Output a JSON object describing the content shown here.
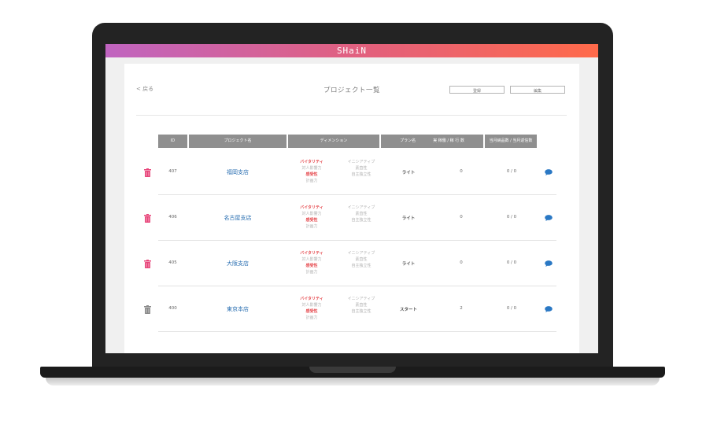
{
  "app": {
    "title": "SHaiN"
  },
  "toolbar": {
    "back_label": "< 戻る",
    "page_title": "プロジェクト一覧",
    "register_label": "登録",
    "edit_label": "編集"
  },
  "table": {
    "headers": {
      "id": "ID",
      "name": "プロジェクト名",
      "dimension": "ディメンション",
      "plan": "プラン名",
      "count": "実 稼働 / 稼 行 数",
      "summary": "当月納品数 / 当月返信数"
    },
    "rows": [
      {
        "id": "407",
        "name": "福岡支店",
        "dim_left": [
          "バイタリティ",
          "対人影響力",
          "感受性",
          "計画力"
        ],
        "dim_right": [
          "イニシアティブ",
          "素直性",
          "自主独立性"
        ],
        "plan": "ライト",
        "count": "0",
        "summary": "0 / 0",
        "trash_color": "#e8457a"
      },
      {
        "id": "406",
        "name": "名古屋支店",
        "dim_left": [
          "バイタリティ",
          "対人影響力",
          "感受性",
          "計画力"
        ],
        "dim_right": [
          "イニシアティブ",
          "素直性",
          "自主独立性"
        ],
        "plan": "ライト",
        "count": "0",
        "summary": "0 / 0",
        "trash_color": "#e8457a"
      },
      {
        "id": "405",
        "name": "大阪支店",
        "dim_left": [
          "バイタリティ",
          "対人影響力",
          "感受性",
          "計画力"
        ],
        "dim_right": [
          "イニシアティブ",
          "素直性",
          "自主独立性"
        ],
        "plan": "ライト",
        "count": "0",
        "summary": "0 / 0",
        "trash_color": "#e8457a"
      },
      {
        "id": "400",
        "name": "東京本店",
        "dim_left": [
          "バイタリティ",
          "対人影響力",
          "感受性",
          "計画力"
        ],
        "dim_right": [
          "イニシアティブ",
          "素直性",
          "自主独立性"
        ],
        "plan": "スタート",
        "count": "2",
        "summary": "0 / 0",
        "trash_color": "#8a8a8a"
      }
    ]
  },
  "colors": {
    "accent_start": "#c064c0",
    "accent_end": "#ff6a4a",
    "link": "#2a6fb2",
    "highlight": "#e5484d"
  }
}
